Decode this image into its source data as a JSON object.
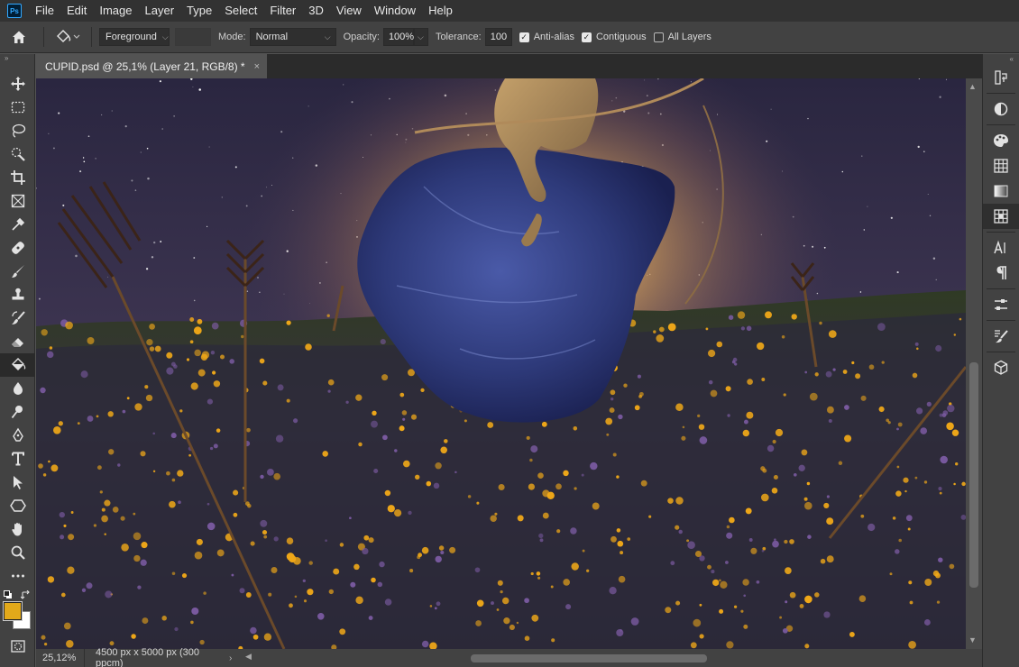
{
  "menubar": {
    "logo": "Ps",
    "items": [
      "File",
      "Edit",
      "Image",
      "Layer",
      "Type",
      "Select",
      "Filter",
      "3D",
      "View",
      "Window",
      "Help"
    ]
  },
  "options": {
    "fill_source": "Foreground",
    "mode_label": "Mode:",
    "mode_value": "Normal",
    "opacity_label": "Opacity:",
    "opacity_value": "100%",
    "tolerance_label": "Tolerance:",
    "tolerance_value": "100",
    "antialias_label": "Anti-alias",
    "antialias_checked": true,
    "contiguous_label": "Contiguous",
    "contiguous_checked": true,
    "all_layers_label": "All Layers",
    "all_layers_checked": false
  },
  "document": {
    "tab_title": "CUPID.psd @ 25,1% (Layer 21, RGB/8) *",
    "close_glyph": "×"
  },
  "status": {
    "zoom": "25,12%",
    "doc_size": "4500 px x 5000 px (300 ppcm)",
    "arrow": "›"
  },
  "toolbar": {
    "active_tool": "paint-bucket",
    "foreground_color": "#e2a91a",
    "background_color": "#ffffff"
  },
  "rightpanel": {
    "icons": [
      "history",
      "adjustments",
      "swatches-palette",
      "grid",
      "gradient",
      "layers-panel",
      "character",
      "paragraph",
      "properties",
      "brushes",
      "3d-cube"
    ]
  }
}
